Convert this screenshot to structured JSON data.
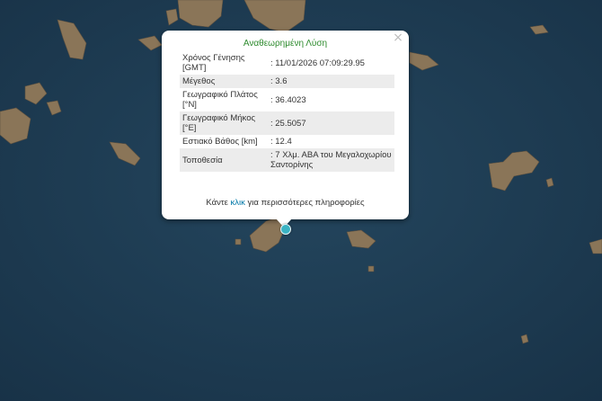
{
  "popup": {
    "title": "Αναθεωρημένη Λύση",
    "close_symbol": "×",
    "rows": [
      {
        "label": "Χρόνος Γένησης [GMT]",
        "value": ": 11/01/2026 07:09:29.95"
      },
      {
        "label": "Μέγεθος",
        "value": ": 3.6"
      },
      {
        "label": "Γεωγραφικό Πλάτος [°N]",
        "value": ": 36.4023"
      },
      {
        "label": "Γεωγραφικό Μήκος [°E]",
        "value": ": 25.5057"
      },
      {
        "label": "Εστιακό Βάθος [km]",
        "value": ": 12.4"
      },
      {
        "label": "Τοποθεσία",
        "value": ": 7 Χλμ. ΑΒΑ του Μεγαλοχωρίου Σαντορίνης"
      }
    ],
    "more_prefix": "Κάντε",
    "more_link": "κλικ",
    "more_suffix": "για περισσότερες πληροφορίες"
  },
  "colors": {
    "sea": "#1f3d52",
    "land": "#8a7558",
    "popup_title": "#2e8b2e",
    "link": "#0078a8",
    "marker": "#3bb3c3"
  },
  "icons": {
    "close": "close-icon",
    "marker": "earthquake-epicenter-marker"
  }
}
